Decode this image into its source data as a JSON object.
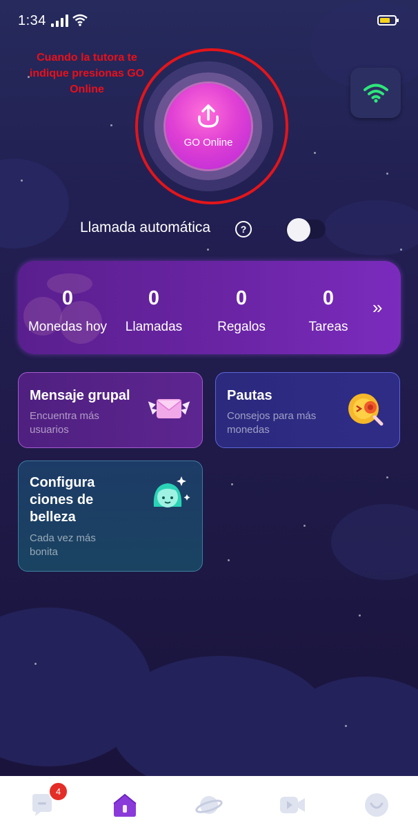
{
  "status_bar": {
    "time": "1:34"
  },
  "annotation": {
    "text": "Cuando la tutora te indique presionas GO Online",
    "color": "#e3151a"
  },
  "go_button": {
    "label": "GO Online"
  },
  "auto_call": {
    "label": "Llamada automática",
    "help": "?",
    "enabled": false
  },
  "stats": {
    "items": [
      {
        "value": "0",
        "label": "Monedas hoy"
      },
      {
        "value": "0",
        "label": "Llamadas"
      },
      {
        "value": "0",
        "label": "Regalos"
      },
      {
        "value": "0",
        "label": "Tareas"
      }
    ],
    "more": "»"
  },
  "cards": [
    {
      "title": "Mensaje grupal",
      "subtitle": "Encuentra más usuarios",
      "icon": "envelope-icon"
    },
    {
      "title": "Pautas",
      "subtitle": "Consejos para más monedas",
      "icon": "coin-search-icon"
    },
    {
      "title": "Configura ciones de belleza",
      "subtitle": "Cada vez más bonita",
      "icon": "beauty-face-icon"
    }
  ],
  "nav": {
    "items": [
      {
        "name": "messages",
        "icon": "chat-icon",
        "badge": "4"
      },
      {
        "name": "home",
        "icon": "home-icon",
        "active": true
      },
      {
        "name": "discover",
        "icon": "planet-icon"
      },
      {
        "name": "video",
        "icon": "video-icon"
      },
      {
        "name": "profile",
        "icon": "smile-icon"
      }
    ]
  },
  "colors": {
    "accent": "#e040d4",
    "wifi": "#2ee67a",
    "badge": "#e52d27"
  }
}
